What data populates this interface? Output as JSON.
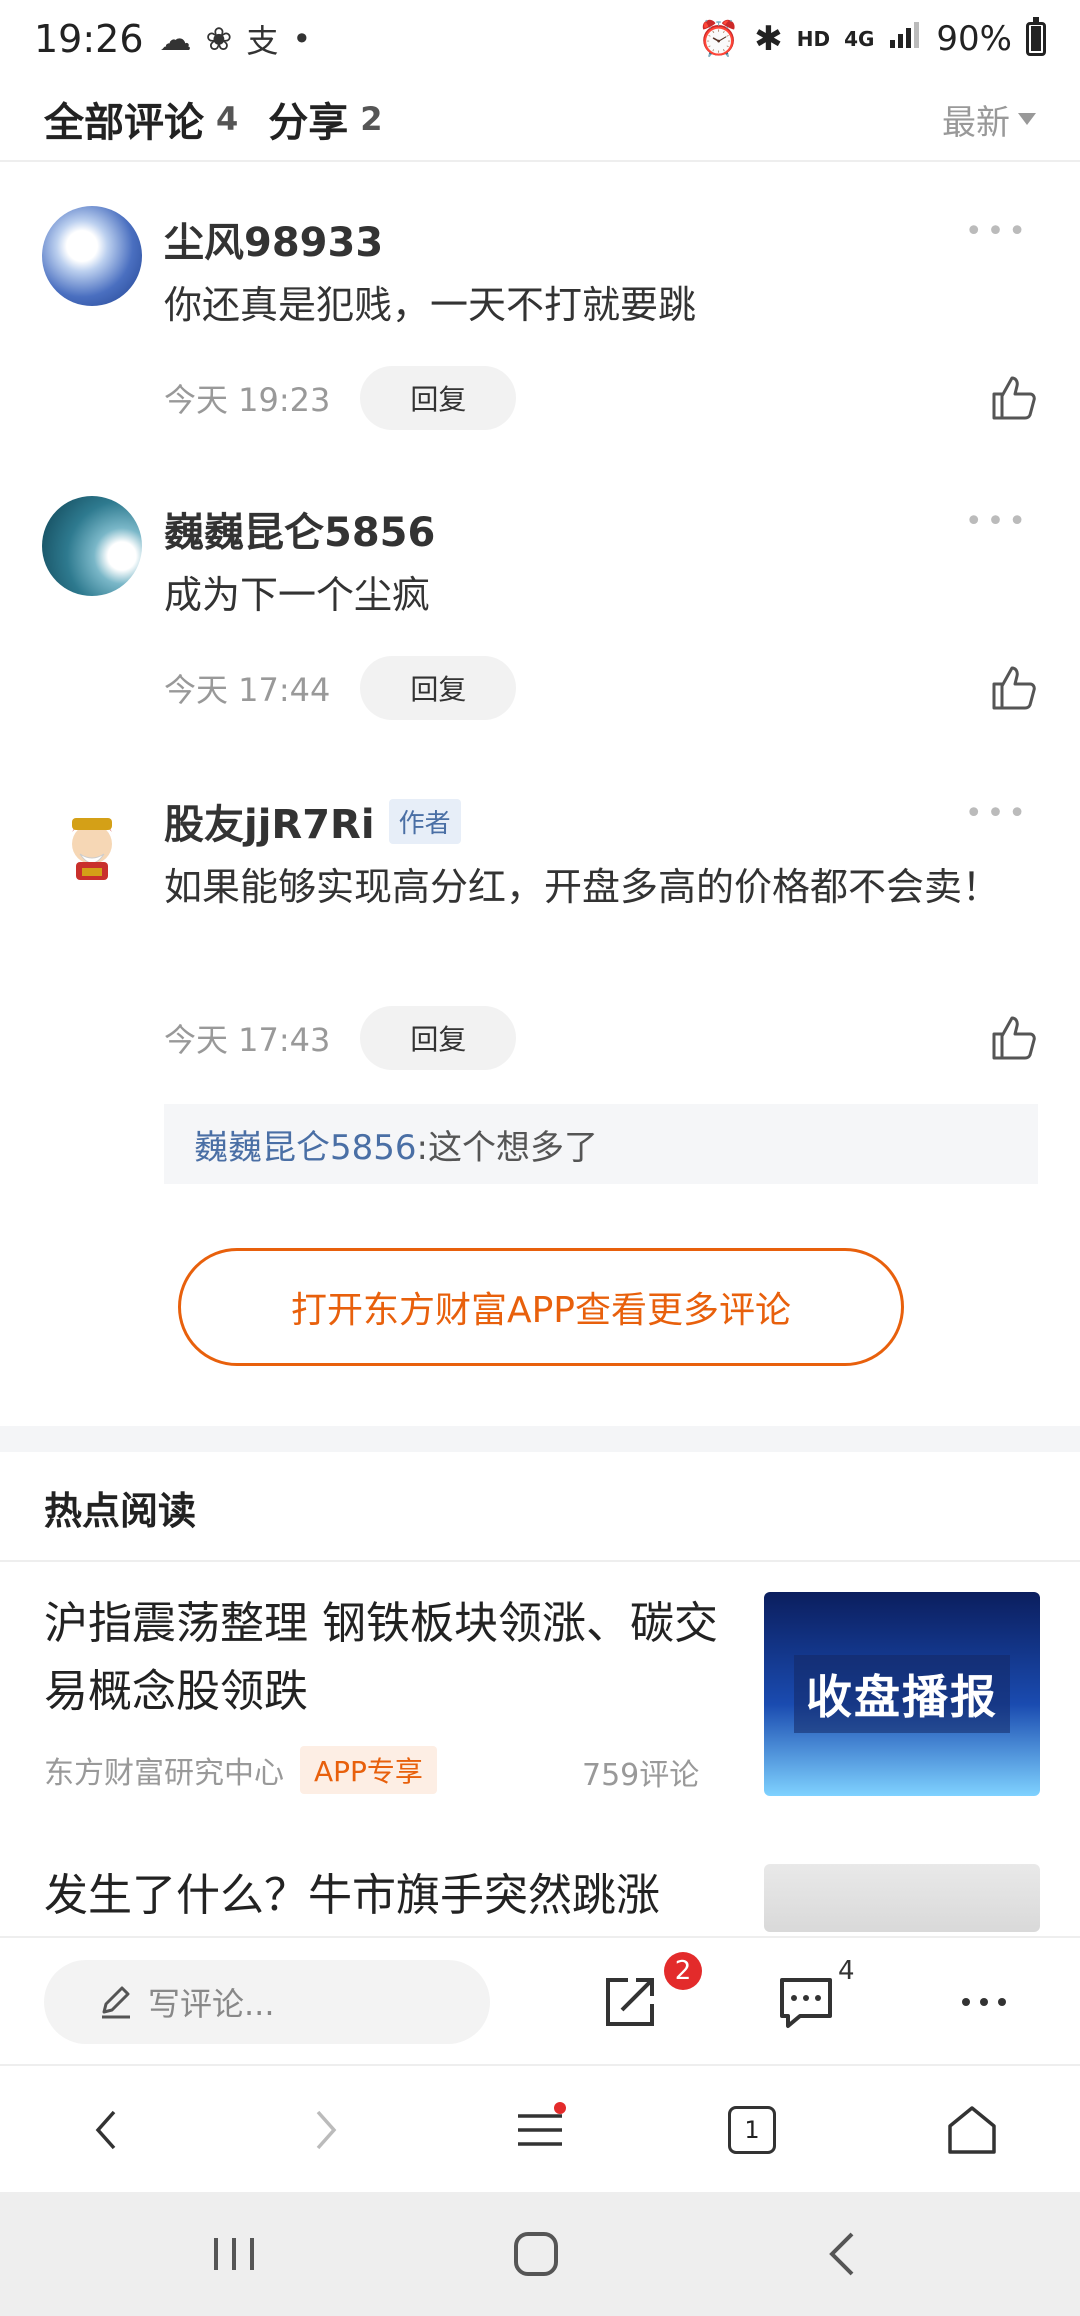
{
  "status": {
    "time": "19:26",
    "net": "HD",
    "signal": "4G",
    "battery": "90%",
    "battery_level": 0.9
  },
  "comments_header": {
    "all_label": "全部评论",
    "all_count": "4",
    "share_label": "分享",
    "share_count": "2",
    "sort_label": "最新"
  },
  "comments": [
    {
      "author": "尘风98933",
      "text": "你还真是犯贱，一天不打就要跳",
      "time": "今天 19:23",
      "reply_label": "回复"
    },
    {
      "author": "巍巍昆仑5856",
      "text": "成为下一个尘疯",
      "time": "今天 17:44",
      "reply_label": "回复"
    },
    {
      "author": "股友jjR7Ri",
      "author_tag": "作者",
      "text": "如果能够实现高分红，开盘多高的价格都不会卖！",
      "time": "今天 17:43",
      "reply_label": "回复",
      "sub_reply": {
        "name": "巍巍昆仑5856",
        "text": ":这个想多了"
      }
    }
  ],
  "open_app_label": "打开东方财富APP查看更多评论",
  "hot_reading": {
    "title": "热点阅读",
    "articles": [
      {
        "title": "沪指震荡整理 钢铁板块领涨、碳交易概念股领跌",
        "source": "东方财富研究中心",
        "badge": "APP专享",
        "comments": "759评论",
        "thumb_text": "收盘播报"
      },
      {
        "title": "发生了什么？牛市旗手突然跳涨"
      }
    ]
  },
  "bottom_bar": {
    "write_placeholder": "写评论...",
    "share_badge": "2",
    "comment_count": "4"
  },
  "browser_nav": {
    "tab_count": "1"
  },
  "colors": {
    "accent": "#e8600c",
    "link": "#4a6fa5",
    "badge_red": "#e32b2b"
  }
}
